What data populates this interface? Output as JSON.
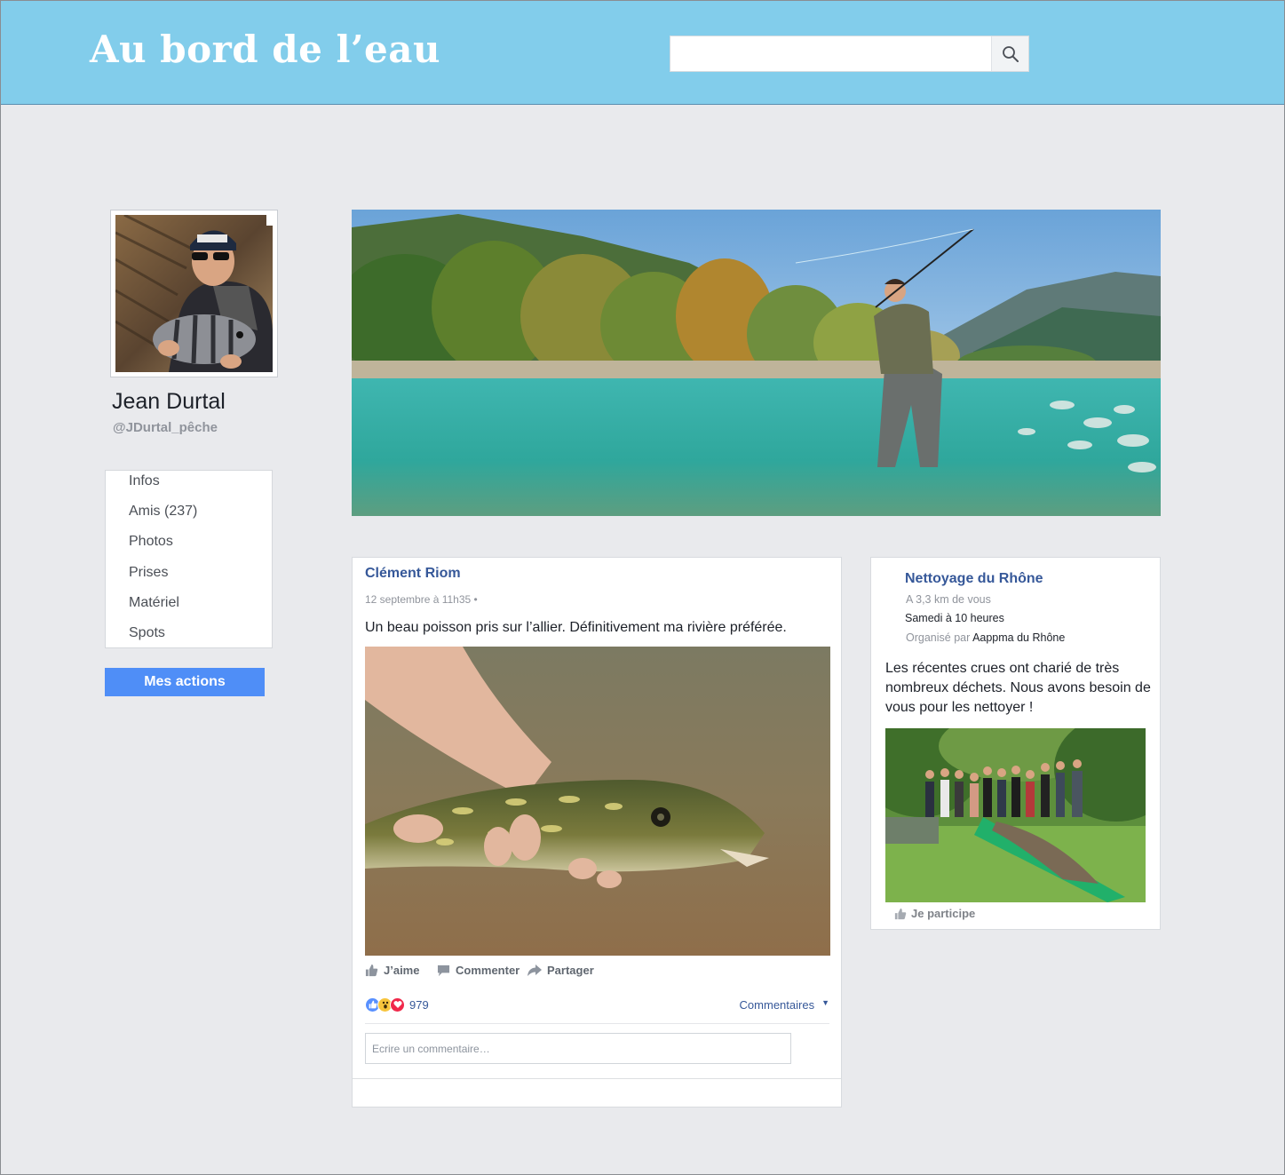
{
  "header": {
    "brand": "Au bord de l’eau",
    "search_placeholder": "",
    "search_icon": "search-icon"
  },
  "profile": {
    "name": "Jean Durtal",
    "handle": "@JDurtal_pêche"
  },
  "menu": {
    "items": [
      {
        "label": "Infos"
      },
      {
        "label": "Amis (237)"
      },
      {
        "label": "Photos"
      },
      {
        "label": "Prises"
      },
      {
        "label": "Matériel"
      },
      {
        "label": "Spots"
      }
    ],
    "actions_button": "Mes actions"
  },
  "post": {
    "author": "Clément Riom",
    "date": "12 septembre à 11h35 •",
    "text": "Un beau poisson pris sur l’allier. Définitivement ma rivière préférée.",
    "actions": {
      "like": "J’aime",
      "comment": "Commenter",
      "share": "Partager"
    },
    "reactions": {
      "icons": [
        "like-icon",
        "wow-icon",
        "love-icon"
      ],
      "count": "979"
    },
    "comments_label": "Commentaires",
    "comment_placeholder": "Ecrire un commentaire…"
  },
  "event": {
    "title": "Nettoyage du Rhône",
    "distance": "A 3,3 km de vous",
    "when": "Samedi à 10 heures",
    "organizer_prefix": "Organisé par",
    "organizer": "Aappma du Rhône",
    "description": "Les récentes crues ont charié de très nombreux déchets. Nous avons besoin de vous pour les nettoyer !",
    "join_label": "Je participe"
  },
  "colors": {
    "header_bg": "#82cdeb",
    "page_bg": "#e9eaed",
    "link_blue": "#365899",
    "button_blue": "#4f8ef7"
  }
}
